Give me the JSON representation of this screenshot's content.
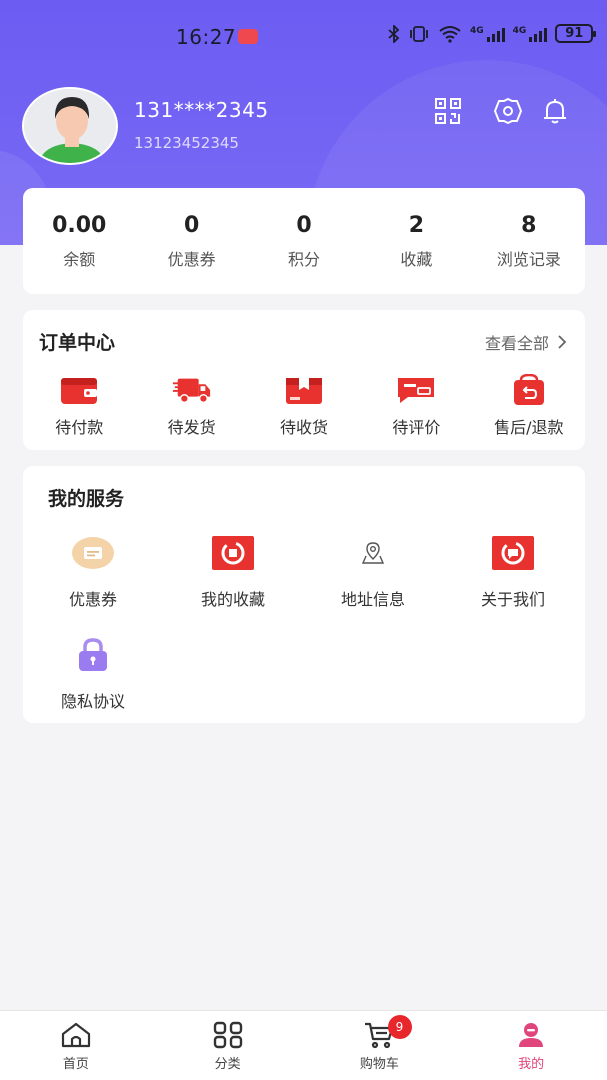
{
  "status_bar": {
    "time": "16:27",
    "network_label": "4G",
    "battery": "91"
  },
  "profile": {
    "username": "131****2345",
    "phone": "13123452345"
  },
  "stats": [
    {
      "value": "0.00",
      "label": "余额"
    },
    {
      "value": "0",
      "label": "优惠券"
    },
    {
      "value": "0",
      "label": "积分"
    },
    {
      "value": "2",
      "label": "收藏"
    },
    {
      "value": "8",
      "label": "浏览记录"
    }
  ],
  "orders": {
    "title": "订单中心",
    "view_all": "查看全部",
    "items": [
      {
        "label": "待付款",
        "icon": "wallet-icon"
      },
      {
        "label": "待发货",
        "icon": "truck-icon"
      },
      {
        "label": "待收货",
        "icon": "package-icon"
      },
      {
        "label": "待评价",
        "icon": "review-icon"
      },
      {
        "label": "售后/退款",
        "icon": "refund-icon"
      }
    ]
  },
  "services": {
    "title": "我的服务",
    "items": [
      {
        "label": "优惠券",
        "icon": "coupon-icon"
      },
      {
        "label": "我的收藏",
        "icon": "favorite-icon"
      },
      {
        "label": "地址信息",
        "icon": "location-icon"
      },
      {
        "label": "关于我们",
        "icon": "chat-icon"
      },
      {
        "label": "隐私协议",
        "icon": "lock-icon"
      }
    ]
  },
  "bottom_nav": {
    "items": [
      {
        "label": "首页",
        "icon": "home-icon"
      },
      {
        "label": "分类",
        "icon": "grid-icon"
      },
      {
        "label": "购物车",
        "icon": "cart-icon"
      },
      {
        "label": "我的",
        "icon": "user-icon"
      }
    ],
    "cart_badge": "9",
    "active": "我的"
  },
  "colors": {
    "header": "#6c5cf2",
    "accent_red": "#e8322f",
    "active_tab": "#e0457b"
  }
}
